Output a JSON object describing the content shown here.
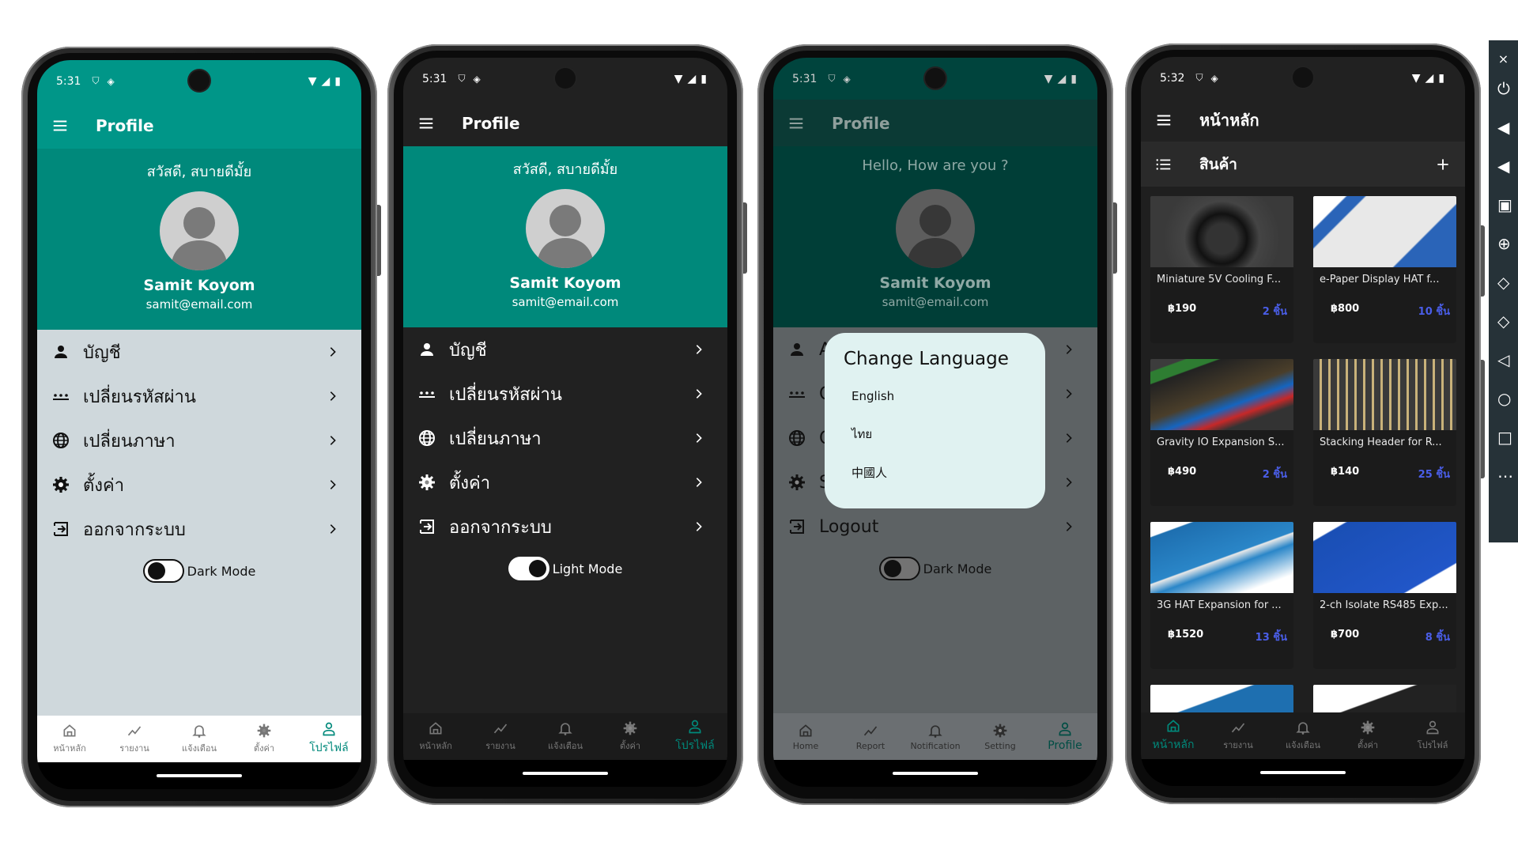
{
  "status": {
    "time_a": "5:31",
    "time_b": "5:32"
  },
  "phone1": {
    "title": "Profile",
    "greeting": "สวัสดี, สบายดีมั้ย",
    "name": "Samit Koyom",
    "email": "samit@email.com",
    "menu": [
      "บัญชี",
      "เปลี่ยนรหัสผ่าน",
      "เปลี่ยนภาษา",
      "ตั้งค่า",
      "ออกจากระบบ"
    ],
    "mode_label": "Dark Mode",
    "mode_on": false,
    "nav": [
      "หน้าหลัก",
      "รายงาน",
      "แจ้งเตือน",
      "ตั้งค่า",
      "โปรไฟล์"
    ],
    "active_nav": "โปรไฟล์"
  },
  "phone2": {
    "title": "Profile",
    "greeting": "สวัสดี, สบายดีมั้ย",
    "name": "Samit Koyom",
    "email": "samit@email.com",
    "menu": [
      "บัญชี",
      "เปลี่ยนรหัสผ่าน",
      "เปลี่ยนภาษา",
      "ตั้งค่า",
      "ออกจากระบบ"
    ],
    "mode_label": "Light Mode",
    "mode_on": true,
    "nav": [
      "หน้าหลัก",
      "รายงาน",
      "แจ้งเตือน",
      "ตั้งค่า",
      "โปรไฟล์"
    ],
    "active_nav": "โปรไฟล์"
  },
  "phone3": {
    "title": "Profile",
    "greeting": "Hello, How are you ?",
    "name": "Samit Koyom",
    "email": "samit@email.com",
    "menu": [
      "A",
      "C",
      "C",
      "S",
      "Logout"
    ],
    "mode_label": "Dark Mode",
    "mode_on": false,
    "nav": [
      "Home",
      "Report",
      "Notification",
      "Setting",
      "Profile"
    ],
    "active_nav": "Profile",
    "dialog": {
      "title": "Change Language",
      "options": [
        "English",
        "ไทย",
        "中國人"
      ]
    }
  },
  "phone4": {
    "title": "หน้าหลัก",
    "section": "สินค้า",
    "products": [
      {
        "name": "Miniature 5V Cooling F...",
        "price": "฿190",
        "qty": "2 ชิ้น"
      },
      {
        "name": "e-Paper Display HAT f...",
        "price": "฿800",
        "qty": "10 ชิ้น"
      },
      {
        "name": "Gravity IO Expansion S...",
        "price": "฿490",
        "qty": "2 ชิ้น"
      },
      {
        "name": "Stacking Header for R...",
        "price": "฿140",
        "qty": "25 ชิ้น"
      },
      {
        "name": "3G HAT Expansion for ...",
        "price": "฿1520",
        "qty": "13 ชิ้น"
      },
      {
        "name": "2-ch Isolate RS485 Exp...",
        "price": "฿700",
        "qty": "8 ชิ้น"
      }
    ],
    "nav": [
      "หน้าหลัก",
      "รายงาน",
      "แจ้งเตือน",
      "ตั้งค่า",
      "โปรไฟล์"
    ],
    "active_nav": "หน้าหลัก"
  },
  "emulator_toolbar": [
    "close-icon",
    "power-icon",
    "volume-up-icon",
    "volume-down-icon",
    "camera-icon",
    "zoom-icon",
    "rotate-left-icon",
    "rotate-right-icon",
    "back-icon",
    "home-icon",
    "overview-icon",
    "more-icon"
  ],
  "colors": {
    "primary": "#009688",
    "header": "#00897b",
    "light_bg": "#cfd8dc",
    "dark_bg": "#212121",
    "dialog_bg": "#e0f2f1",
    "qty": "#4a5ee8"
  }
}
